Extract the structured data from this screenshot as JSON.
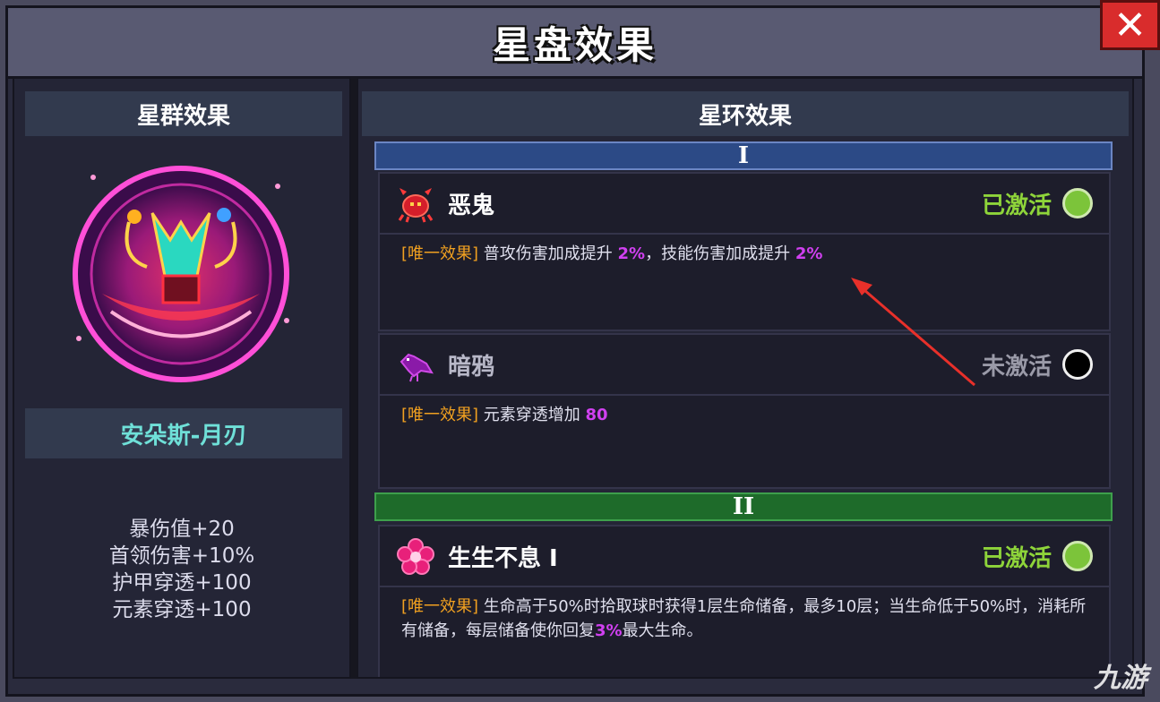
{
  "title": "星盘效果",
  "left_panel": {
    "header": "星群效果",
    "constellation_name": "安朵斯-月刃",
    "stats": [
      "暴伤值+20",
      "首领伤害+10%",
      "护甲穿透+100",
      "元素穿透+100"
    ]
  },
  "right_panel": {
    "header": "星环效果",
    "tiers": [
      {
        "label": "I",
        "cards": [
          {
            "name": "恶鬼",
            "icon": "crab-icon",
            "status": "已激活",
            "active": true,
            "desc": {
              "tag": "[唯一效果]",
              "p1": "普攻伤害加成提升",
              "v1": "2%",
              "p2": "，技能伤害加成提升",
              "v2": "2%"
            }
          },
          {
            "name": "暗鸦",
            "icon": "crow-icon",
            "status": "未激活",
            "active": false,
            "desc": {
              "tag": "[唯一效果]",
              "p1": "元素穿透增加",
              "v1": "80"
            }
          }
        ]
      },
      {
        "label": "II",
        "cards": [
          {
            "name": "生生不息 I",
            "icon": "flower-icon",
            "status": "已激活",
            "active": true,
            "desc": {
              "tag": "[唯一效果]",
              "p1": "生命高于50%时拾取球时获得1层生命储备，最多10层；当生命低于50%时，消耗所有储备，每层储备使你回复",
              "v1": "3%",
              "p2": "最大生命。"
            }
          }
        ]
      }
    ]
  },
  "colors": {
    "active": "#8ed43a",
    "inactive": "#9a9aa8",
    "tag": "#f0a020",
    "highlight": "#d040f0",
    "tier1": "#2c4a86",
    "tier2": "#1e6b2a"
  },
  "watermark": "九游"
}
